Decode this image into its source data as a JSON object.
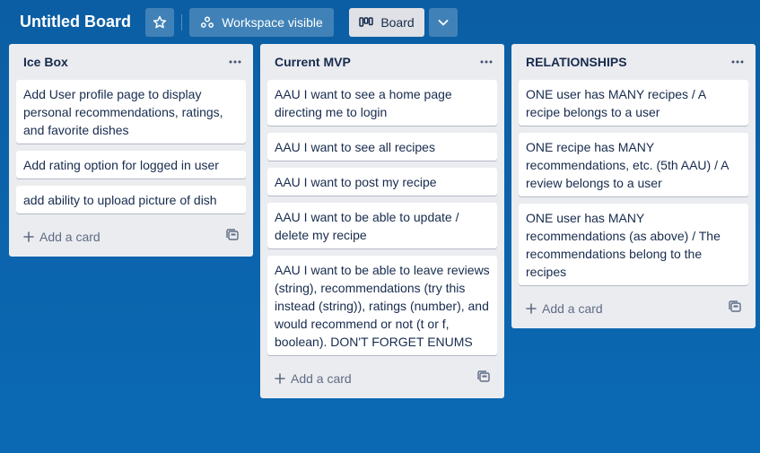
{
  "header": {
    "title": "Untitled Board",
    "workspace_label": "Workspace visible",
    "view_label": "Board"
  },
  "lists": [
    {
      "title": "Ice Box",
      "cards": [
        "Add User profile page to display personal recommendations, ratings, and favorite dishes",
        "Add rating option for logged in user",
        "add ability to upload picture of dish"
      ],
      "add_label": "Add a card"
    },
    {
      "title": "Current MVP",
      "cards": [
        "AAU I want to see a home page directing me to login",
        "AAU I want to see all recipes",
        "AAU I want to post my recipe",
        "AAU I want to be able to update / delete my recipe",
        "AAU I want to be able to leave reviews (string), recommendations (try this instead (string)), ratings (number), and would recommend or not (t or f, boolean). DON'T FORGET ENUMS"
      ],
      "add_label": "Add a card"
    },
    {
      "title": "RELATIONSHIPS",
      "cards": [
        "ONE user has MANY recipes / A recipe belongs to a user",
        "ONE recipe has MANY recommendations, etc. (5th AAU) / A review belongs to a user",
        "ONE user has MANY recommendations (as above) / The recommendations belong to the recipes"
      ],
      "add_label": "Add a card"
    }
  ],
  "icons": {
    "star": "star-icon",
    "workspace": "workspace-visible-icon",
    "board": "board-icon",
    "chevron": "chevron-down-icon",
    "list_menu": "more-horizontal-icon",
    "add": "plus-icon",
    "template": "card-template-icon"
  },
  "colors": {
    "background": "#0b67b0",
    "list_bg": "#ebecf0",
    "card_bg": "#ffffff",
    "text": "#172b4d",
    "muted": "#5e6c84"
  }
}
